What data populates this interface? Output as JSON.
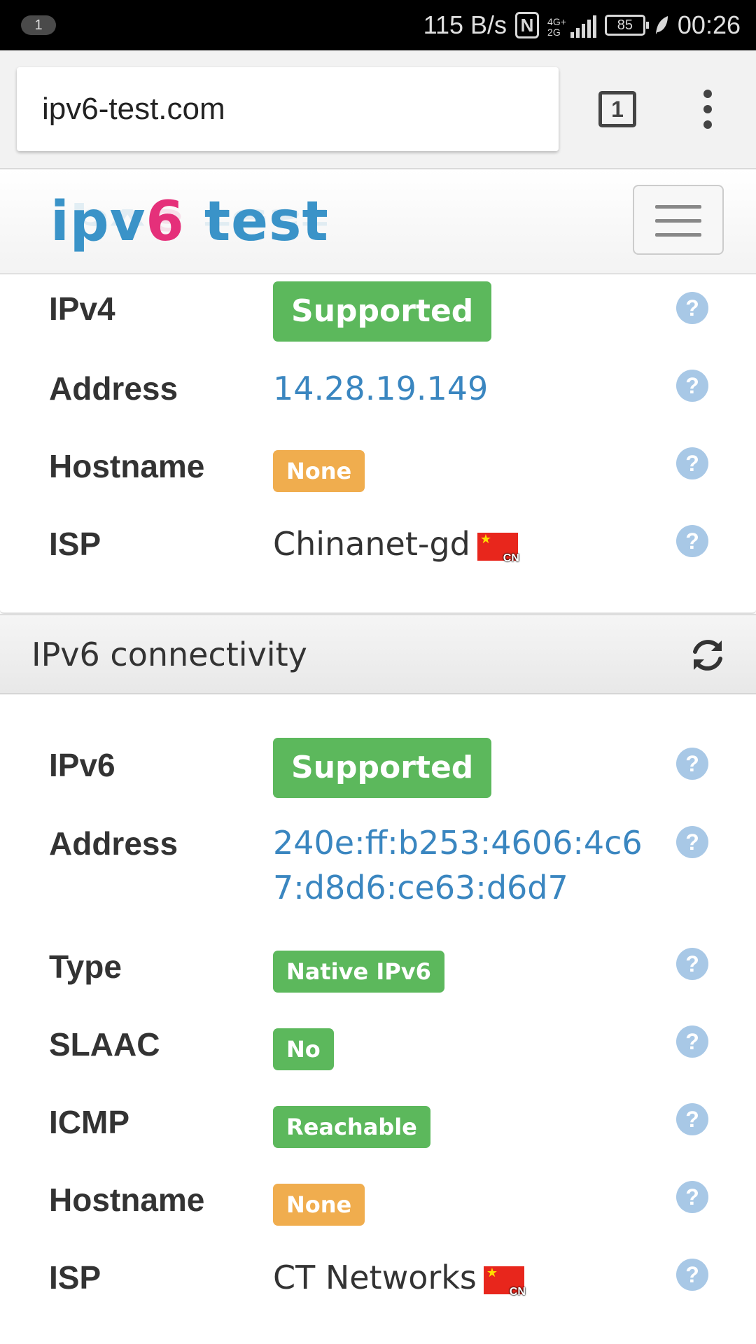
{
  "status_bar": {
    "notification_count": "1",
    "net_speed": "115 B/s",
    "nfc_label": "N",
    "network_type_top": "4G+",
    "network_type_bottom": "2G",
    "battery": "85",
    "time": "00:26"
  },
  "browser": {
    "url": "ipv6-test.com",
    "tab_count": "1"
  },
  "site": {
    "logo_part1": "ipv",
    "logo_part2": "6",
    "logo_part3": " test"
  },
  "ipv4": {
    "rows": [
      {
        "label": "IPv4",
        "value": "Supported"
      },
      {
        "label": "Address",
        "value": "14.28.19.149"
      },
      {
        "label": "Hostname",
        "value": "None"
      },
      {
        "label": "ISP",
        "value": "Chinanet-gd",
        "country": "CN"
      }
    ]
  },
  "ipv6": {
    "panel_title": "IPv6 connectivity",
    "rows": [
      {
        "label": "IPv6",
        "value": "Supported"
      },
      {
        "label": "Address",
        "value_line1": "240e:ff:b253:4606:4c6",
        "value_line2": "7:d8d6:ce63:d6d7"
      },
      {
        "label": "Type",
        "value": "Native IPv6"
      },
      {
        "label": "SLAAC",
        "value": "No"
      },
      {
        "label": "ICMP",
        "value": "Reachable"
      },
      {
        "label": "Hostname",
        "value": "None"
      },
      {
        "label": "ISP",
        "value": "CT Networks",
        "country": "CN"
      }
    ]
  },
  "help_glyph": "?",
  "flag_star": "★",
  "colors": {
    "success": "#5cb85c",
    "warning": "#f0ad4e",
    "link": "#3a86c0",
    "logo_blue": "#3a93c8",
    "logo_pink": "#e5307a"
  },
  "icons": [
    "nfc-icon",
    "network-signal-icon",
    "battery-icon",
    "leaf-icon",
    "tabs-icon",
    "menu-dots-icon",
    "hamburger-menu-icon",
    "help-icon",
    "flag-cn-icon",
    "refresh-icon"
  ]
}
